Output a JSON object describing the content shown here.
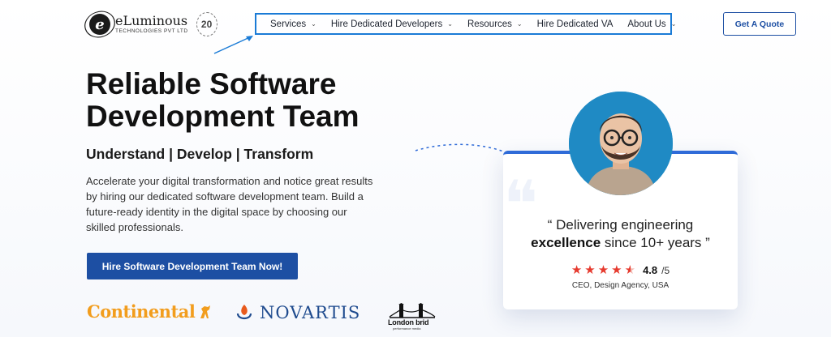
{
  "header": {
    "logo_name": "eLuminous",
    "logo_sub": "TECHNOLOGIES PVT LTD",
    "logo_badge": "20",
    "nav": [
      {
        "label": "Services",
        "has_dropdown": true
      },
      {
        "label": "Hire Dedicated Developers",
        "has_dropdown": true
      },
      {
        "label": "Resources",
        "has_dropdown": true
      },
      {
        "label": "Hire Dedicated VA",
        "has_dropdown": false
      },
      {
        "label": "About Us",
        "has_dropdown": true
      }
    ],
    "quote_button": "Get A Quote"
  },
  "hero": {
    "title": "Reliable Software Development Team",
    "tagline": "Understand | Develop | Transform",
    "description": "Accelerate your digital transformation and notice great results by hiring our dedicated software development team. Build a future-ready identity in the digital space by choosing our skilled professionals.",
    "cta": "Hire Software Development Team Now!"
  },
  "clients": {
    "continental": "Continental",
    "novartis": "NOVARTIS",
    "london": "London brid",
    "london_sub": "performance media"
  },
  "testimonial": {
    "quote_line1": "“ Delivering engineering",
    "quote_bold": "excellence",
    "quote_rest": " since 10+ years ”",
    "rating_value": "4.8",
    "rating_max": "/5",
    "stars": 4.5,
    "attribution": "CEO, Design Agency, USA"
  },
  "colors": {
    "primary": "#1d4fa3",
    "nav_highlight": "#1a7bd6",
    "star": "#e63a2e",
    "continental": "#f29d1d",
    "novartis": "#1f4b8e"
  }
}
